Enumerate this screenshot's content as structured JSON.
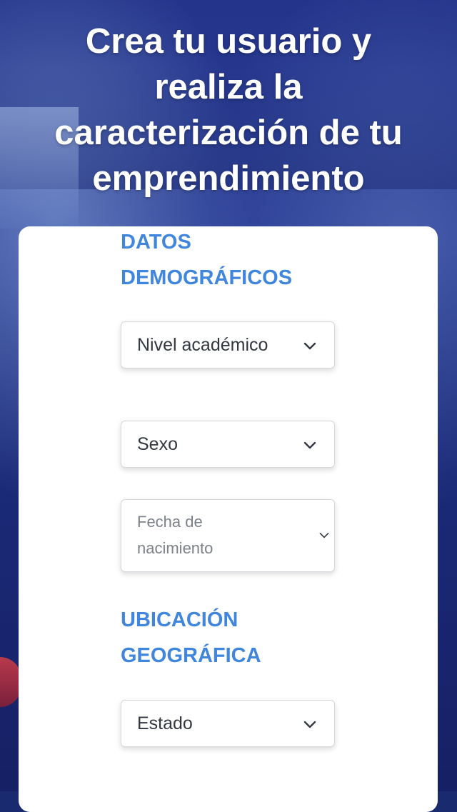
{
  "header": {
    "title_lines": [
      "Crea tu usuario y",
      "realiza la",
      "caracterización de tu",
      "emprendimiento"
    ]
  },
  "form": {
    "section_demographic": {
      "title_lines": [
        "DATOS",
        "DEMOGRÁFICOS"
      ]
    },
    "academic_level": {
      "label": "Nivel académico",
      "icon": "chevron-down-icon"
    },
    "sex": {
      "label": "Sexo",
      "icon": "chevron-down-icon"
    },
    "birth_date": {
      "placeholder_lines": [
        "Fecha de",
        "nacimiento"
      ],
      "icon": "chevron-down-icon"
    },
    "section_location": {
      "title_lines": [
        "UBICACIÓN",
        "GEOGRÁFICA"
      ]
    },
    "state": {
      "label": "Estado",
      "icon": "chevron-down-icon"
    }
  },
  "colors": {
    "accent": "#3f86dc",
    "hero_bg": "#24348a",
    "card_bg": "#ffffff",
    "field_text": "#333840",
    "placeholder_text": "#7d828a"
  }
}
